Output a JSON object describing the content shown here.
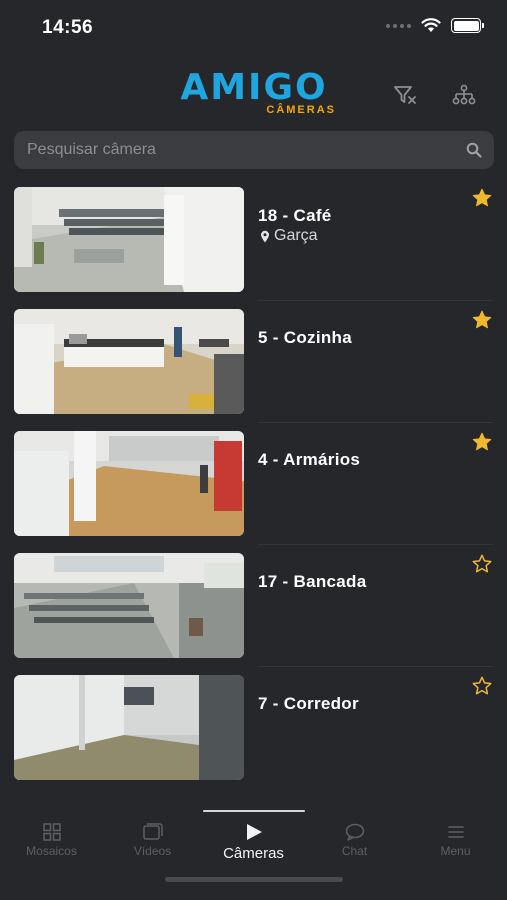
{
  "status": {
    "time": "14:56"
  },
  "header": {
    "logo_main": "AMIGO",
    "logo_sub": "CÂMERAS"
  },
  "search": {
    "placeholder": "Pesquisar câmera"
  },
  "cameras": [
    {
      "name": "18 - Café",
      "location": "Garça",
      "favorite": true
    },
    {
      "name": "5 - Cozinha",
      "location": "",
      "favorite": true
    },
    {
      "name": "4 - Armários",
      "location": "",
      "favorite": true
    },
    {
      "name": "17 - Bancada",
      "location": "",
      "favorite": false
    },
    {
      "name": "7 - Corredor",
      "location": "",
      "favorite": false
    }
  ],
  "tabs": [
    {
      "label": "Mosaicos",
      "icon": "grid-icon"
    },
    {
      "label": "Vídeos",
      "icon": "videos-icon"
    },
    {
      "label": "Câmeras",
      "icon": "play-icon",
      "active": true
    },
    {
      "label": "Chat",
      "icon": "chat-icon"
    },
    {
      "label": "Menu",
      "icon": "menu-icon"
    }
  ],
  "colors": {
    "accent_blue": "#1fa6e0",
    "accent_orange": "#f2a900",
    "star": "#f0b82d",
    "background": "#26272b"
  }
}
